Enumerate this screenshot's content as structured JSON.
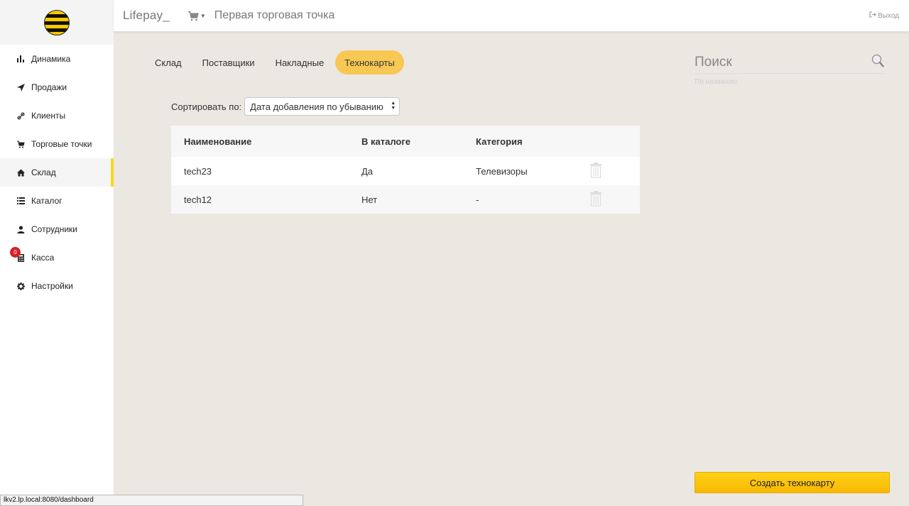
{
  "topbar": {
    "brand": "Lifepay_",
    "store_name": "Первая торговая точка",
    "logout": "Выход"
  },
  "sidebar": {
    "items": [
      {
        "label": "Динамика",
        "icon": "bar-chart-icon"
      },
      {
        "label": "Продажи",
        "icon": "send-icon"
      },
      {
        "label": "Клиенты",
        "icon": "link-icon"
      },
      {
        "label": "Торговые точки",
        "icon": "cart-icon"
      },
      {
        "label": "Склад",
        "icon": "home-icon",
        "active": true
      },
      {
        "label": "Каталог",
        "icon": "list-icon"
      },
      {
        "label": "Сотрудники",
        "icon": "user-icon"
      },
      {
        "label": "Касса",
        "icon": "calculator-icon",
        "badge": "0"
      },
      {
        "label": "Настройки",
        "icon": "gear-icon"
      }
    ]
  },
  "tabs": [
    {
      "label": "Склад"
    },
    {
      "label": "Поставщики"
    },
    {
      "label": "Накладные"
    },
    {
      "label": "Технокарты",
      "active": true
    }
  ],
  "sort": {
    "label": "Сортировать по:",
    "selected": "Дата добавления по убыванию"
  },
  "table": {
    "headers": [
      "Наименование",
      "В каталоге",
      "Категория"
    ],
    "rows": [
      {
        "name": "tech23",
        "in_catalog": "Да",
        "category": "Телевизоры"
      },
      {
        "name": "tech12",
        "in_catalog": "Нет",
        "category": "-"
      }
    ]
  },
  "search": {
    "placeholder": "Поиск",
    "hint": "По названию"
  },
  "create_button": "Создать технокарту",
  "statusbar": "lkv2.lp.local:8080/dashboard",
  "colors": {
    "accent": "#f8c854",
    "button": "#ffc800",
    "active_indicator": "#f8d820",
    "badge": "#d4202a"
  }
}
